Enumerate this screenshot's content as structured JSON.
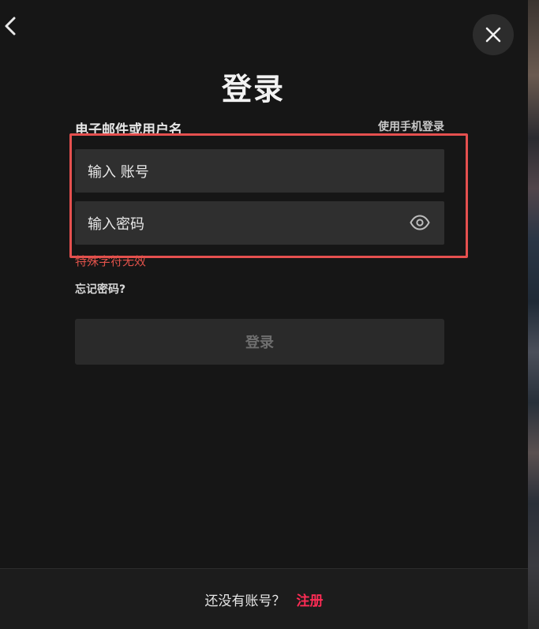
{
  "title": "登录",
  "field_label": "电子邮件或用户名",
  "phone_login_link": "使用手机登录",
  "account_input": {
    "placeholder": "输入 账号"
  },
  "password_input": {
    "placeholder": "输入密码"
  },
  "error_message": "特殊字符无效",
  "forgot_password": "忘记密码?",
  "login_button": "登录",
  "footer": {
    "question": "还没有账号？",
    "signup_link": "注册"
  },
  "icons": {
    "back": "chevron-left-icon",
    "close": "close-icon",
    "password_visibility": "eye-icon"
  },
  "colors": {
    "background": "#161616",
    "input_background": "#2f2f2f",
    "highlight_border": "#e5504f",
    "error_text": "#e0524a",
    "signup_link": "#fe2c55",
    "disabled_button_text": "#6e6e6e"
  }
}
